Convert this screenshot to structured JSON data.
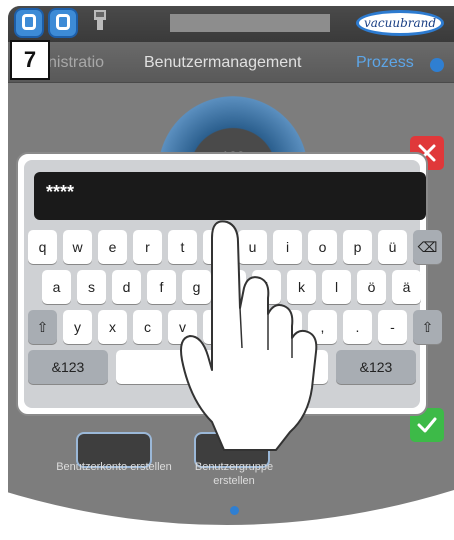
{
  "step_number": "7",
  "header": {
    "logo_text": "vacuubrand"
  },
  "tabs": {
    "left": "nistratio",
    "center": "Benutzermanagement",
    "right": "Prozess"
  },
  "gauge": {
    "value": "100"
  },
  "keyboard": {
    "password_value": "****",
    "rows": [
      [
        "q",
        "w",
        "e",
        "r",
        "t",
        "z",
        "u",
        "i",
        "o",
        "p",
        "ü"
      ],
      [
        "a",
        "s",
        "d",
        "f",
        "g",
        "h",
        "j",
        "k",
        "l",
        "ö",
        "ä"
      ],
      [
        "y",
        "x",
        "c",
        "v",
        "b",
        "n",
        "m",
        ",",
        ".",
        "-"
      ]
    ],
    "mode_key_left": "&123",
    "mode_key_right": "&123"
  },
  "bottom": {
    "item1_label": "Benutzerkonto erstellen",
    "item2_label": "Benutzergruppe erstellen"
  },
  "colors": {
    "accent_blue": "#2f7fd2",
    "close_red": "#e0383a",
    "confirm_green": "#3dba48"
  },
  "icons": [
    "backspace-icon",
    "shift-icon",
    "close-icon",
    "checkmark-icon",
    "touch-hand-icon"
  ]
}
